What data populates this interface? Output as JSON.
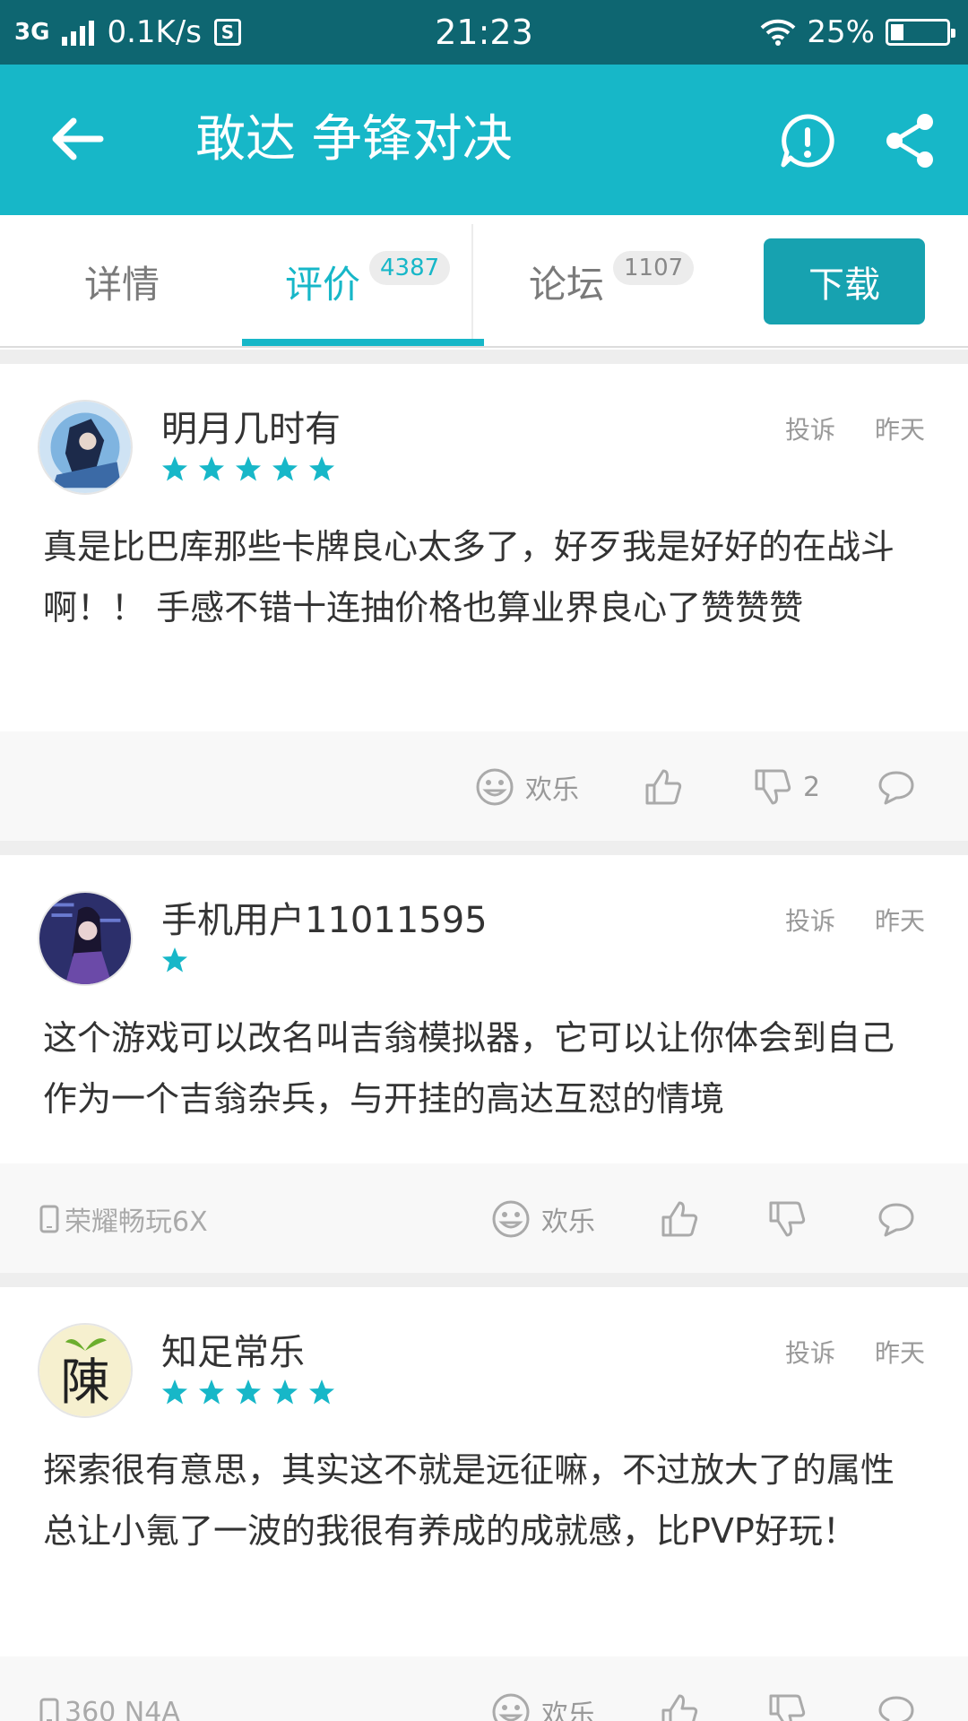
{
  "status_bar": {
    "network": "3G",
    "speed": "0.1K/s",
    "time": "21:23",
    "battery": "25%"
  },
  "app_bar": {
    "title": "敢达 争锋对决"
  },
  "tabs": {
    "details": "详情",
    "reviews": "评价",
    "reviews_count": "4387",
    "forum": "论坛",
    "forum_count": "1107",
    "download": "下载"
  },
  "reviews": [
    {
      "user": "明月几时有",
      "rating": 5,
      "report": "投诉",
      "date": "昨天",
      "content": "真是比巴库那些卡牌良心太多了，好歹我是好好的在战斗啊！！ 手感不错十连抽价格也算业界良心了赞赞赞",
      "device": "",
      "emotion": "欢乐",
      "dislikes": "2"
    },
    {
      "user": "手机用户11011595",
      "rating": 1,
      "report": "投诉",
      "date": "昨天",
      "content": "这个游戏可以改名叫吉翁模拟器，它可以让你体会到自己作为一个吉翁杂兵，与开挂的高达互怼的情境",
      "device": "荣耀畅玩6X",
      "emotion": "欢乐",
      "dislikes": ""
    },
    {
      "user": "知足常乐",
      "rating": 5,
      "report": "投诉",
      "date": "昨天",
      "content": "探索很有意思，其实这不就是远征嘛，不过放大了的属性总让小氪了一波的我很有养成的成就感，比PVP好玩！",
      "device": "360 N4A",
      "emotion": "欢乐",
      "dislikes": ""
    }
  ],
  "colors": {
    "status_bar": "#0e6671",
    "accent": "#17b7c8",
    "download": "#17a2b0"
  }
}
